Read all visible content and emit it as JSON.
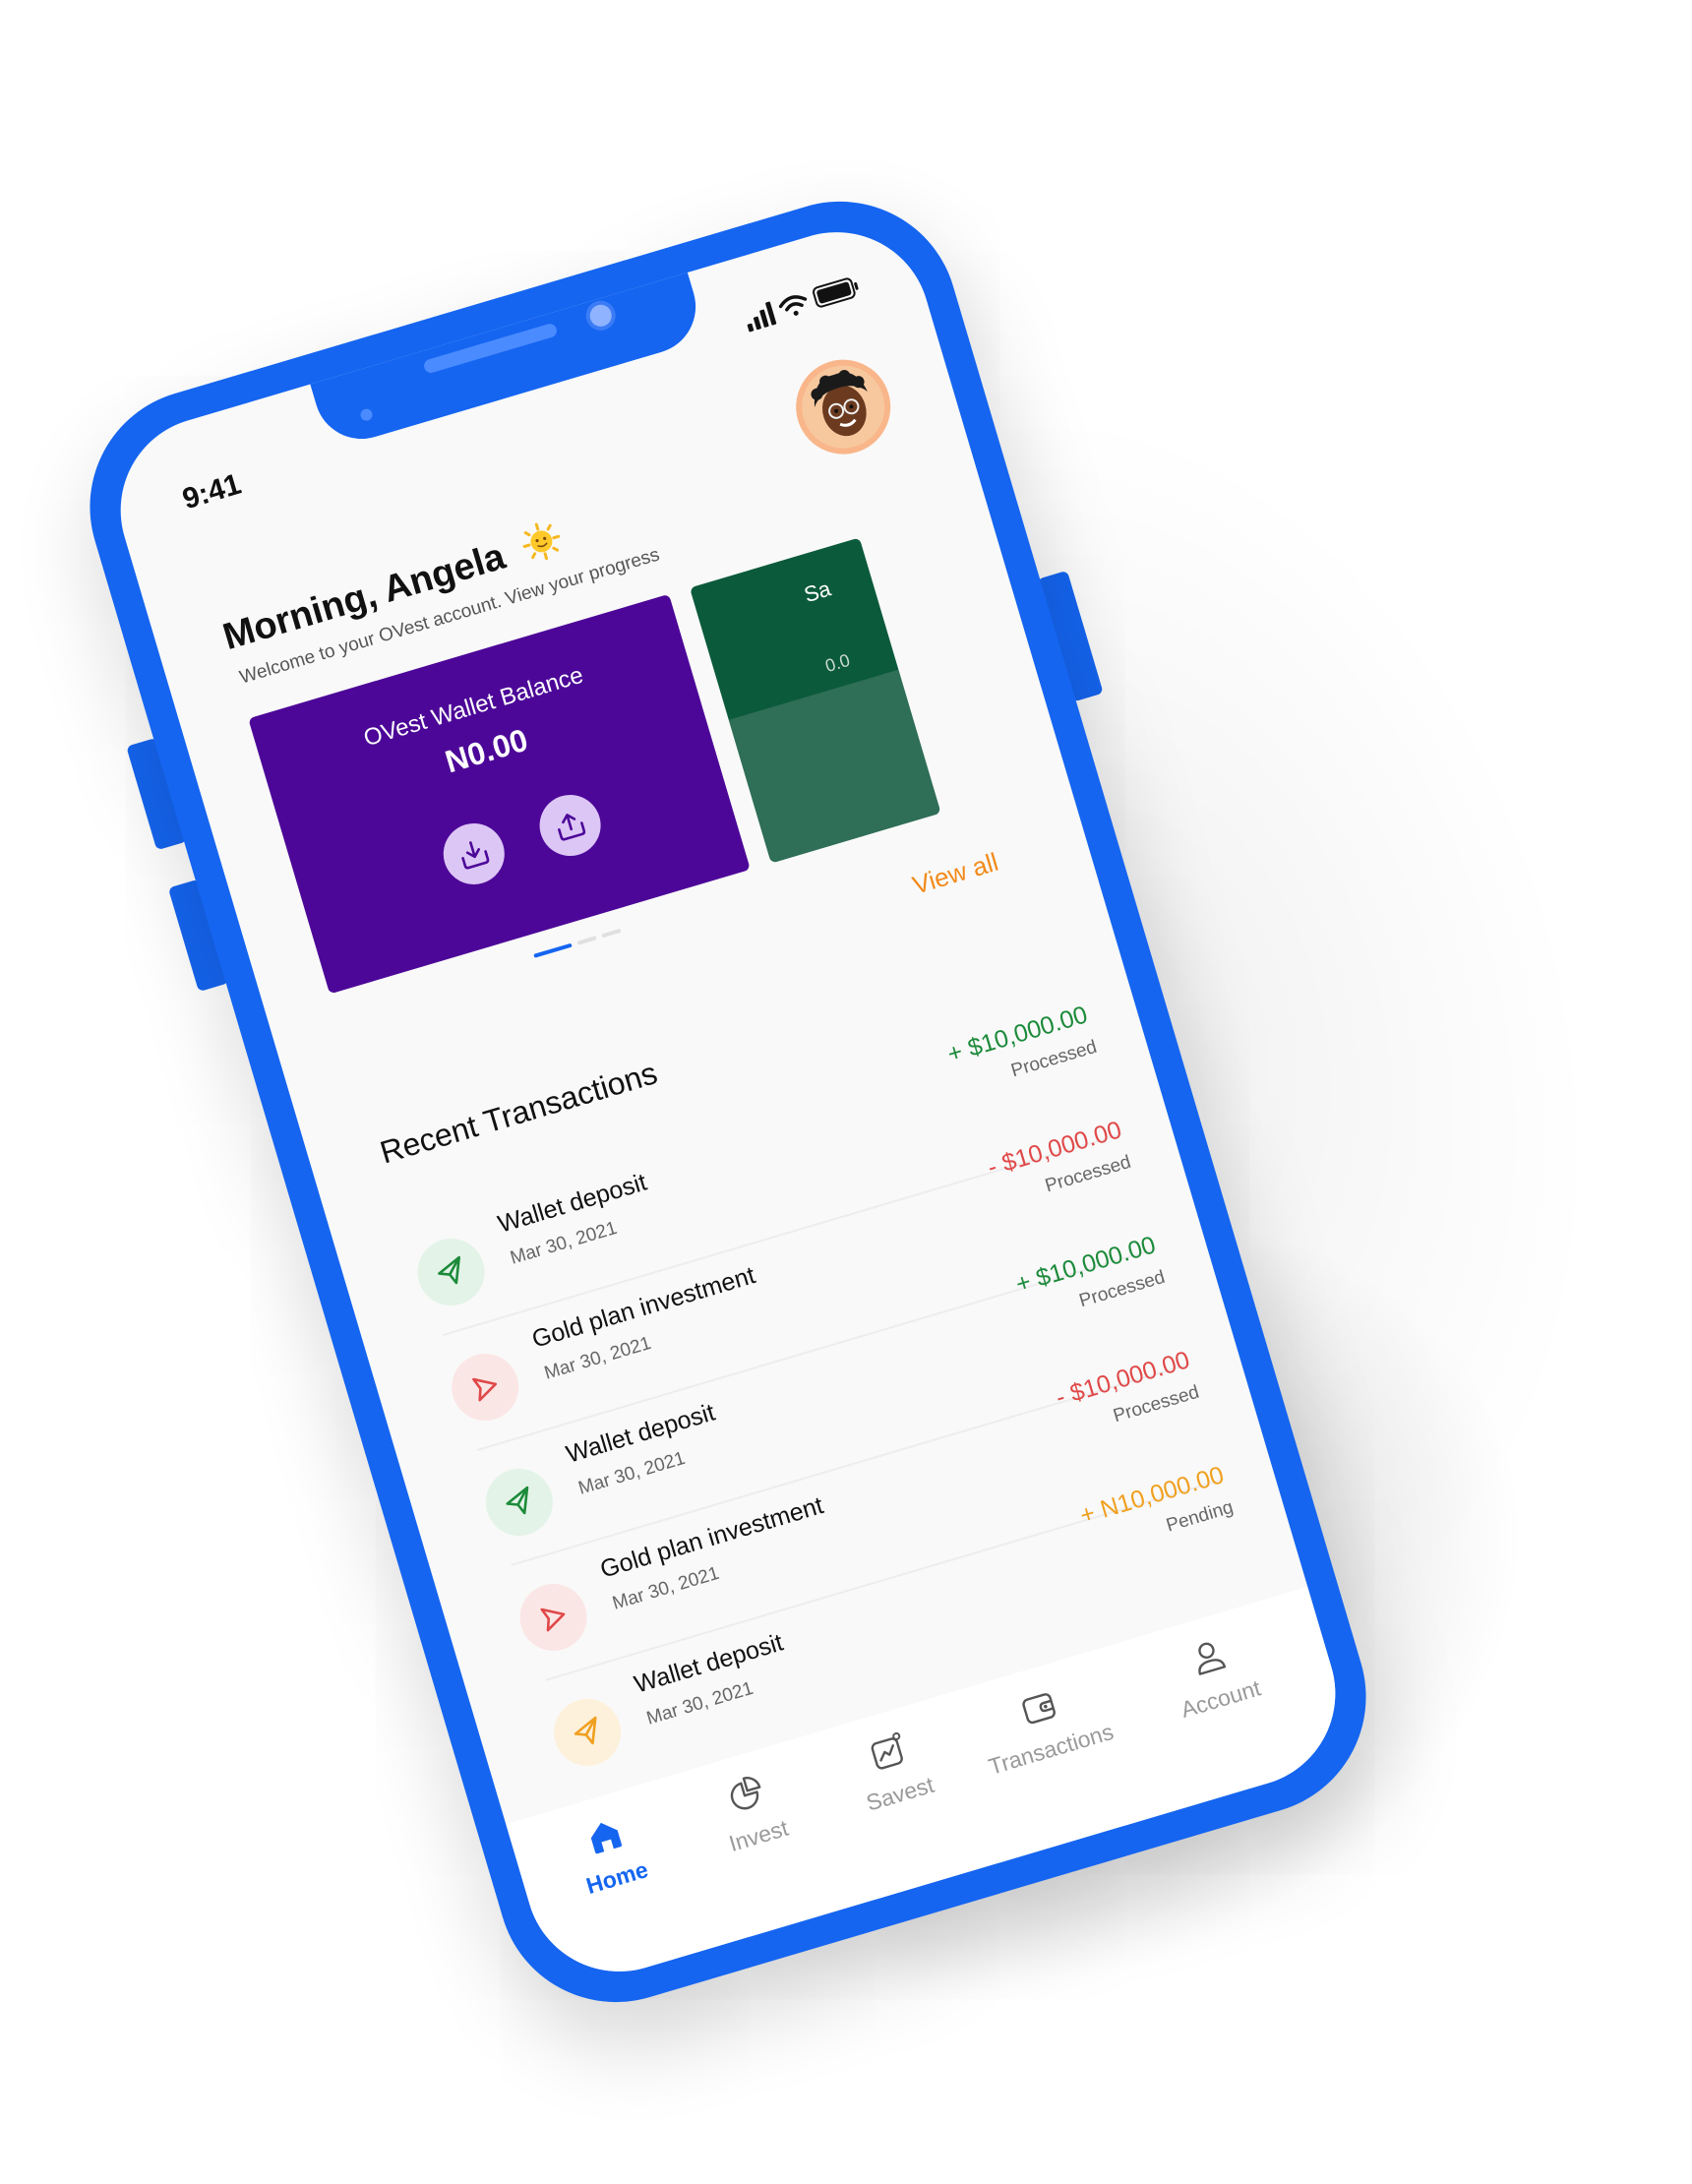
{
  "status_bar": {
    "time": "9:41"
  },
  "header": {
    "greeting": "Morning, Angela",
    "subtitle": "Welcome to your OVest account. View your progress"
  },
  "wallet_card": {
    "title": "OVest Wallet Balance",
    "amount": "N0.00",
    "color": "#4c0798"
  },
  "savings_card": {
    "label": "Sa",
    "amount": "0.0",
    "color": "#0b5a3c"
  },
  "carousel": {
    "active_index": 0,
    "count": 3
  },
  "transactions": {
    "title": "Recent Transactions",
    "view_all": "View all",
    "items": [
      {
        "name": "Wallet deposit",
        "date": "Mar 30, 2021",
        "amount": "+ $10,000.00",
        "status": "Processed",
        "kind": "deposit",
        "color": "#1c8a3a"
      },
      {
        "name": "Gold plan investment",
        "date": "Mar 30, 2021",
        "amount": "- $10,000.00",
        "status": "Processed",
        "kind": "investment",
        "color": "#e04848"
      },
      {
        "name": "Wallet deposit",
        "date": "Mar 30, 2021",
        "amount": "+ $10,000.00",
        "status": "Processed",
        "kind": "deposit",
        "color": "#1c8a3a"
      },
      {
        "name": "Gold plan investment",
        "date": "Mar 30, 2021",
        "amount": "- $10,000.00",
        "status": "Processed",
        "kind": "investment",
        "color": "#e04848"
      },
      {
        "name": "Wallet deposit",
        "date": "Mar 30, 2021",
        "amount": "+ N10,000.00",
        "status": "Pending",
        "kind": "pending",
        "color": "#f0a020"
      }
    ]
  },
  "bottom_nav": {
    "active": "Home",
    "items": [
      {
        "label": "Home",
        "icon": "home-icon"
      },
      {
        "label": "Invest",
        "icon": "pie-chart-icon"
      },
      {
        "label": "Savest",
        "icon": "chart-icon"
      },
      {
        "label": "Transactions",
        "icon": "wallet-icon"
      },
      {
        "label": "Account",
        "icon": "user-icon"
      }
    ]
  },
  "colors": {
    "phone_frame": "#1565f0",
    "accent_orange": "#f28a1a",
    "positive": "#1c8a3a",
    "negative": "#e04848",
    "pending": "#f0a020"
  }
}
